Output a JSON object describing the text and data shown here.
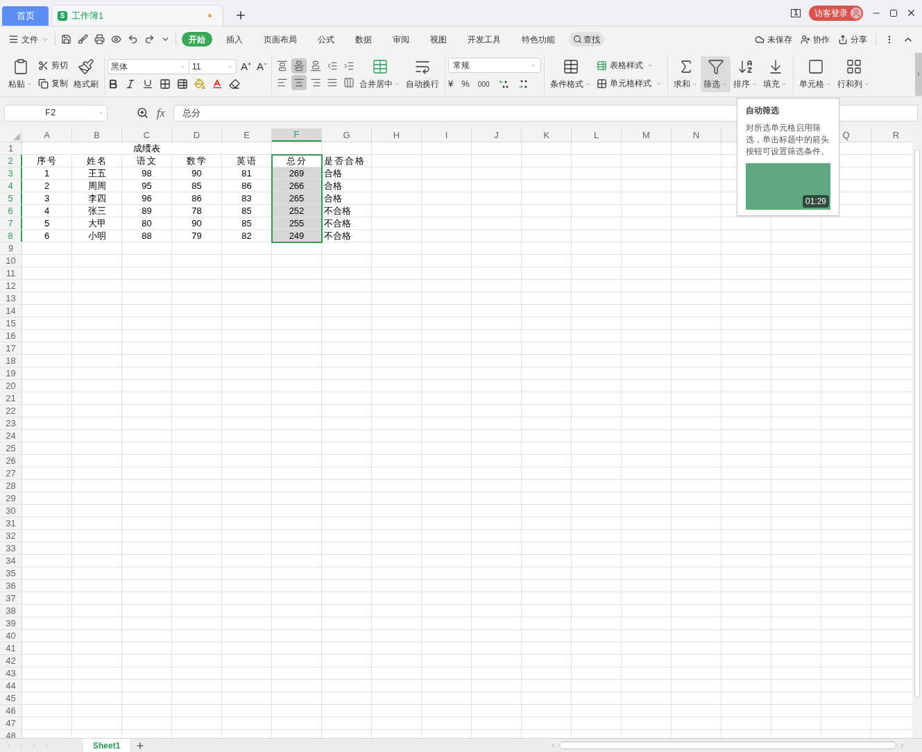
{
  "title_bar": {
    "home_tab": "首页",
    "doc_tab": {
      "label": "工作簿1",
      "icon_letter": "S",
      "unsaved": true
    },
    "badge": "1",
    "login": "访客登录"
  },
  "menu": {
    "file": "文件",
    "tabs": [
      {
        "label": "开始",
        "selected": true
      },
      {
        "label": "插入",
        "selected": false
      },
      {
        "label": "页面布局",
        "selected": false
      },
      {
        "label": "公式",
        "selected": false
      },
      {
        "label": "数据",
        "selected": false
      },
      {
        "label": "审阅",
        "selected": false
      },
      {
        "label": "视图",
        "selected": false
      },
      {
        "label": "开发工具",
        "selected": false
      },
      {
        "label": "特色功能",
        "selected": false
      }
    ],
    "search": "查找",
    "unsaved": "未保存",
    "collab": "协作",
    "share": "分享"
  },
  "ribbon": {
    "paste": "粘贴",
    "cut": "剪切",
    "copy": "复制",
    "painter": "格式刷",
    "font": "黑体",
    "size": "11",
    "grow": "A⁺",
    "shrink": "A⁻",
    "align_top": [
      {
        "kind": "top",
        "selected": false
      },
      {
        "kind": "middle",
        "selected": true
      },
      {
        "kind": "bottom",
        "selected": false
      },
      {
        "kind": "outdent",
        "selected": false
      },
      {
        "kind": "indent",
        "selected": false
      }
    ],
    "align_bottom": [
      {
        "kind": "left",
        "selected": false
      },
      {
        "kind": "center",
        "selected": true
      },
      {
        "kind": "right",
        "selected": false
      },
      {
        "kind": "justify",
        "selected": false
      },
      {
        "kind": "distribute",
        "selected": false
      }
    ],
    "merge": "合并居中",
    "wrap": "自动换行",
    "number_format": "常规",
    "currency": "¥",
    "percent": "%",
    "thousands": "000",
    "cond_format": "条件格式",
    "table_style": "表格样式",
    "cell_style": "单元格样式",
    "tools": [
      {
        "kind": "sum",
        "label": "求和",
        "selected": false
      },
      {
        "kind": "filter",
        "label": "筛选",
        "selected": true
      },
      {
        "kind": "sort",
        "label": "排序",
        "selected": false
      },
      {
        "kind": "fill",
        "label": "填充",
        "selected": false
      },
      {
        "kind": "cell",
        "label": "单元格",
        "selected": false
      },
      {
        "kind": "rowcol",
        "label": "行和列",
        "selected": false
      }
    ]
  },
  "formula_bar": {
    "name_box": "F2",
    "fx": "fx",
    "value": "总分"
  },
  "sheet": {
    "columns": [
      {
        "label": "A",
        "selected": false
      },
      {
        "label": "B",
        "selected": false
      },
      {
        "label": "C",
        "selected": false
      },
      {
        "label": "D",
        "selected": false
      },
      {
        "label": "E",
        "selected": false
      },
      {
        "label": "F",
        "selected": true
      },
      {
        "label": "G",
        "selected": false
      },
      {
        "label": "H",
        "selected": false
      },
      {
        "label": "I",
        "selected": false
      },
      {
        "label": "J",
        "selected": false
      },
      {
        "label": "K",
        "selected": false
      },
      {
        "label": "L",
        "selected": false
      },
      {
        "label": "M",
        "selected": false
      },
      {
        "label": "N",
        "selected": false
      },
      {},
      {},
      {
        "label": "Q",
        "selected": false
      },
      {
        "label": "R",
        "selected": false
      }
    ],
    "row_headers": [
      {
        "label": "1",
        "selected": false
      },
      {
        "label": "2",
        "selected": true
      },
      {
        "label": "3",
        "selected": true
      },
      {
        "label": "4",
        "selected": true
      },
      {
        "label": "5",
        "selected": true
      },
      {
        "label": "6",
        "selected": true
      },
      {
        "label": "7",
        "selected": true
      },
      {
        "label": "8",
        "selected": true
      },
      {
        "label": "9",
        "selected": false
      },
      {
        "label": "10",
        "selected": false
      },
      {
        "label": "11",
        "selected": false
      },
      {
        "label": "12",
        "selected": false
      },
      {
        "label": "13",
        "selected": false
      },
      {
        "label": "14",
        "selected": false
      },
      {
        "label": "15",
        "selected": false
      },
      {
        "label": "16",
        "selected": false
      },
      {
        "label": "17",
        "selected": false
      },
      {
        "label": "18",
        "selected": false
      },
      {
        "label": "19",
        "selected": false
      },
      {
        "label": "20",
        "selected": false
      },
      {
        "label": "21",
        "selected": false
      },
      {
        "label": "22",
        "selected": false
      },
      {
        "label": "23",
        "selected": false
      },
      {
        "label": "24",
        "selected": false
      },
      {
        "label": "25",
        "selected": false
      },
      {
        "label": "26",
        "selected": false
      },
      {
        "label": "27",
        "selected": false
      },
      {
        "label": "28",
        "selected": false
      },
      {
        "label": "29",
        "selected": false
      },
      {
        "label": "30",
        "selected": false
      },
      {
        "label": "31",
        "selected": false
      },
      {
        "label": "32",
        "selected": false
      },
      {
        "label": "33",
        "selected": false
      },
      {
        "label": "34",
        "selected": false
      },
      {
        "label": "35",
        "selected": false
      },
      {
        "label": "36",
        "selected": false
      },
      {
        "label": "37",
        "selected": false
      },
      {
        "label": "38",
        "selected": false
      },
      {
        "label": "39",
        "selected": false
      },
      {
        "label": "40",
        "selected": false
      },
      {
        "label": "41",
        "selected": false
      },
      {
        "label": "42",
        "selected": false
      },
      {
        "label": "43",
        "selected": false
      },
      {
        "label": "44",
        "selected": false
      },
      {
        "label": "45",
        "selected": false
      },
      {
        "label": "46",
        "selected": false
      },
      {
        "label": "47",
        "selected": false
      },
      {
        "label": "48",
        "selected": false
      }
    ],
    "title": "成绩表",
    "rows": [
      [
        "序号",
        "姓名",
        "语文",
        "数学",
        "英语",
        "总分",
        "是否合格"
      ],
      [
        "1",
        "王五",
        "98",
        "90",
        "81",
        "269",
        "合格"
      ],
      [
        "2",
        "周周",
        "95",
        "85",
        "86",
        "266",
        "合格"
      ],
      [
        "3",
        "李四",
        "96",
        "86",
        "83",
        "265",
        "合格"
      ],
      [
        "4",
        "张三",
        "89",
        "78",
        "85",
        "252",
        "不合格"
      ],
      [
        "5",
        "大甲",
        "80",
        "90",
        "85",
        "255",
        "不合格"
      ],
      [
        "6",
        "小明",
        "88",
        "79",
        "82",
        "249",
        "不合格"
      ]
    ]
  },
  "tooltip": {
    "title": "自动筛选",
    "body": "对所选单元格启用筛选，单击标题中的箭头按钮可设置筛选条件。",
    "duration": "01:29"
  },
  "sheet_tabs": [
    {
      "label": "Sheet1",
      "selected": true
    }
  ]
}
